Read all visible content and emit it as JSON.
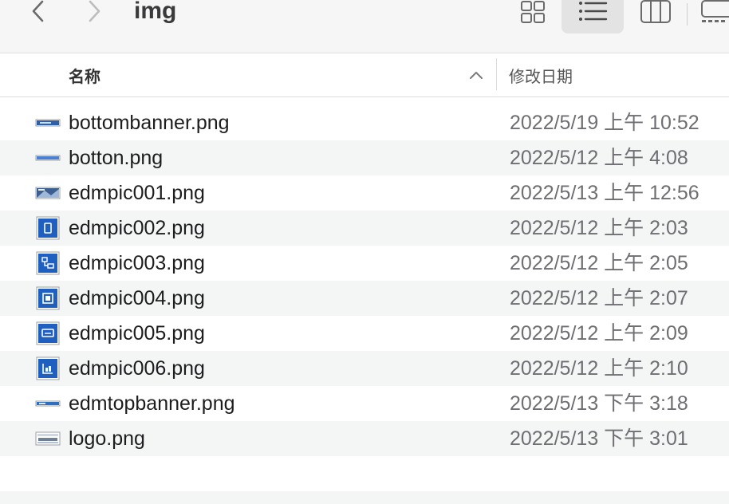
{
  "window": {
    "title": "img"
  },
  "toolbar": {
    "back": {
      "icon": "chevron-left-icon"
    },
    "forward": {
      "icon": "chevron-right-icon"
    },
    "views": [
      {
        "name": "icons",
        "icon": "grid-icon",
        "selected": false
      },
      {
        "name": "list",
        "icon": "list-icon",
        "selected": true
      },
      {
        "name": "columns",
        "icon": "columns-icon",
        "selected": false
      },
      {
        "name": "gallery",
        "icon": "gallery-icon",
        "selected": false
      }
    ]
  },
  "columns": {
    "name_label": "名称",
    "date_label": "修改日期",
    "sort": "ascending"
  },
  "files": [
    {
      "name": "bottombanner.png",
      "date": "2022/5/19 上午 10:52",
      "icon": "banner-thumbnail-icon"
    },
    {
      "name": "botton.png",
      "date": "2022/5/12 上午 4:08",
      "icon": "banner-thumbnail-icon"
    },
    {
      "name": "edmpic001.png",
      "date": "2022/5/13 上午 12:56",
      "icon": "photo-thumbnail-icon"
    },
    {
      "name": "edmpic002.png",
      "date": "2022/5/12 上午 2:03",
      "icon": "blue-square-thumbnail-icon"
    },
    {
      "name": "edmpic003.png",
      "date": "2022/5/12 上午 2:05",
      "icon": "blue-square-thumbnail-icon"
    },
    {
      "name": "edmpic004.png",
      "date": "2022/5/12 上午 2:07",
      "icon": "blue-square-thumbnail-icon"
    },
    {
      "name": "edmpic005.png",
      "date": "2022/5/12 上午 2:09",
      "icon": "blue-square-thumbnail-icon"
    },
    {
      "name": "edmpic006.png",
      "date": "2022/5/12 上午 2:10",
      "icon": "blue-square-thumbnail-icon"
    },
    {
      "name": "edmtopbanner.png",
      "date": "2022/5/13 下午 3:18",
      "icon": "banner-thumbnail-icon"
    },
    {
      "name": "logo.png",
      "date": "2022/5/13 下午 3:01",
      "icon": "logo-thumbnail-icon"
    }
  ],
  "colors": {
    "accent_blue": "#1f5fbf",
    "row_alt": "#f4f5f5",
    "toolbar_bg": "#f6f6f6",
    "date_text": "#6e6e73"
  }
}
